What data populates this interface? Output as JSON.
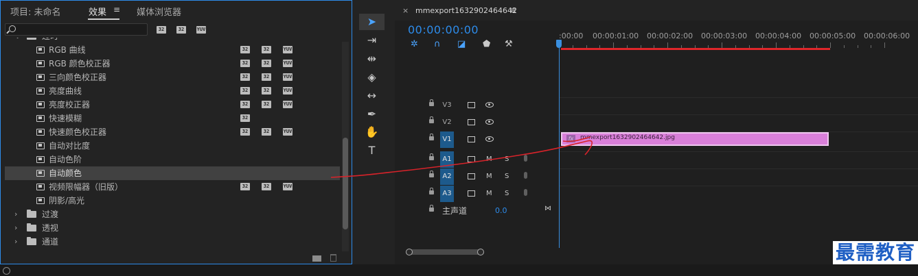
{
  "left_panel": {
    "tabs": [
      {
        "label": "项目: 未命名"
      },
      {
        "label": "效果"
      },
      {
        "label": "媒体浏览器"
      }
    ],
    "menu_icon": "≡",
    "search": {
      "value": "",
      "placeholder": ""
    },
    "filter_badges": [
      "32",
      "32",
      "YUV"
    ],
    "rows": [
      {
        "type": "folder",
        "label": "过时",
        "expanded": true
      },
      {
        "type": "effect",
        "label": "RGB 曲线",
        "badges": [
          "32",
          "32",
          "YUV"
        ]
      },
      {
        "type": "effect",
        "label": "RGB 颜色校正器",
        "badges": [
          "32",
          "32",
          "YUV"
        ]
      },
      {
        "type": "effect",
        "label": "三向颜色校正器",
        "badges": [
          "32",
          "32",
          "YUV"
        ]
      },
      {
        "type": "effect",
        "label": "亮度曲线",
        "badges": [
          "32",
          "32",
          "YUV"
        ]
      },
      {
        "type": "effect",
        "label": "亮度校正器",
        "badges": [
          "32",
          "32",
          "YUV"
        ]
      },
      {
        "type": "effect",
        "label": "快速模糊",
        "badges": [
          "32"
        ]
      },
      {
        "type": "effect",
        "label": "快速颜色校正器",
        "badges": [
          "32",
          "32",
          "YUV"
        ]
      },
      {
        "type": "effect",
        "label": "自动对比度",
        "badges": []
      },
      {
        "type": "effect",
        "label": "自动色阶",
        "badges": []
      },
      {
        "type": "effect",
        "label": "自动颜色",
        "badges": [],
        "selected": true
      },
      {
        "type": "effect",
        "label": "视频限幅器（旧版）",
        "badges": [
          "32",
          "32",
          "YUV"
        ]
      },
      {
        "type": "effect",
        "label": "阴影/高光",
        "badges": []
      },
      {
        "type": "folder",
        "label": "过渡",
        "expanded": false
      },
      {
        "type": "folder",
        "label": "透视",
        "expanded": false
      },
      {
        "type": "folder",
        "label": "通道",
        "expanded": false
      }
    ]
  },
  "tools": [
    {
      "icon": "selection-tool-icon",
      "glyph": "➤",
      "active": true
    },
    {
      "icon": "track-select-tool-icon",
      "glyph": "⇥",
      "active": false
    },
    {
      "icon": "ripple-edit-tool-icon",
      "glyph": "⇹",
      "active": false
    },
    {
      "icon": "razor-tool-icon",
      "glyph": "◈",
      "active": false
    },
    {
      "icon": "slip-tool-icon",
      "glyph": "↔",
      "active": false
    },
    {
      "icon": "pen-tool-icon",
      "glyph": "✒",
      "active": false
    },
    {
      "icon": "hand-tool-icon",
      "glyph": "✋",
      "active": false
    },
    {
      "icon": "type-tool-icon",
      "glyph": "T",
      "active": false
    }
  ],
  "timeline": {
    "close_glyph": "×",
    "sequence_name": "mmexport1632902464642",
    "menu_icon": "≡",
    "timecode": "00:00:00:00",
    "ruler_labels": [
      ":00:00",
      "00:00:01:00",
      "00:00:02:00",
      "00:00:03:00",
      "00:00:04:00",
      "00:00:05:00",
      "00:00:06:00"
    ],
    "video_tracks": [
      {
        "name": "V3",
        "targeted": false
      },
      {
        "name": "V2",
        "targeted": false
      },
      {
        "name": "V1",
        "targeted": true
      }
    ],
    "audio_tracks": [
      {
        "name": "A1",
        "targeted": true,
        "m": "M",
        "s": "S"
      },
      {
        "name": "A2",
        "targeted": true,
        "m": "M",
        "s": "S"
      },
      {
        "name": "A3",
        "targeted": true,
        "m": "M",
        "s": "S"
      }
    ],
    "master": {
      "label": "主声道",
      "value": "0.0"
    },
    "clip": {
      "fx_label": "fx",
      "name": "mmexport1632902464642.jpg",
      "color": "#d97fd9"
    }
  },
  "watermark": "最需教育",
  "colors": {
    "accent": "#2d8ceb",
    "work_area": "#e0262a",
    "annotation": "#d8232a"
  }
}
